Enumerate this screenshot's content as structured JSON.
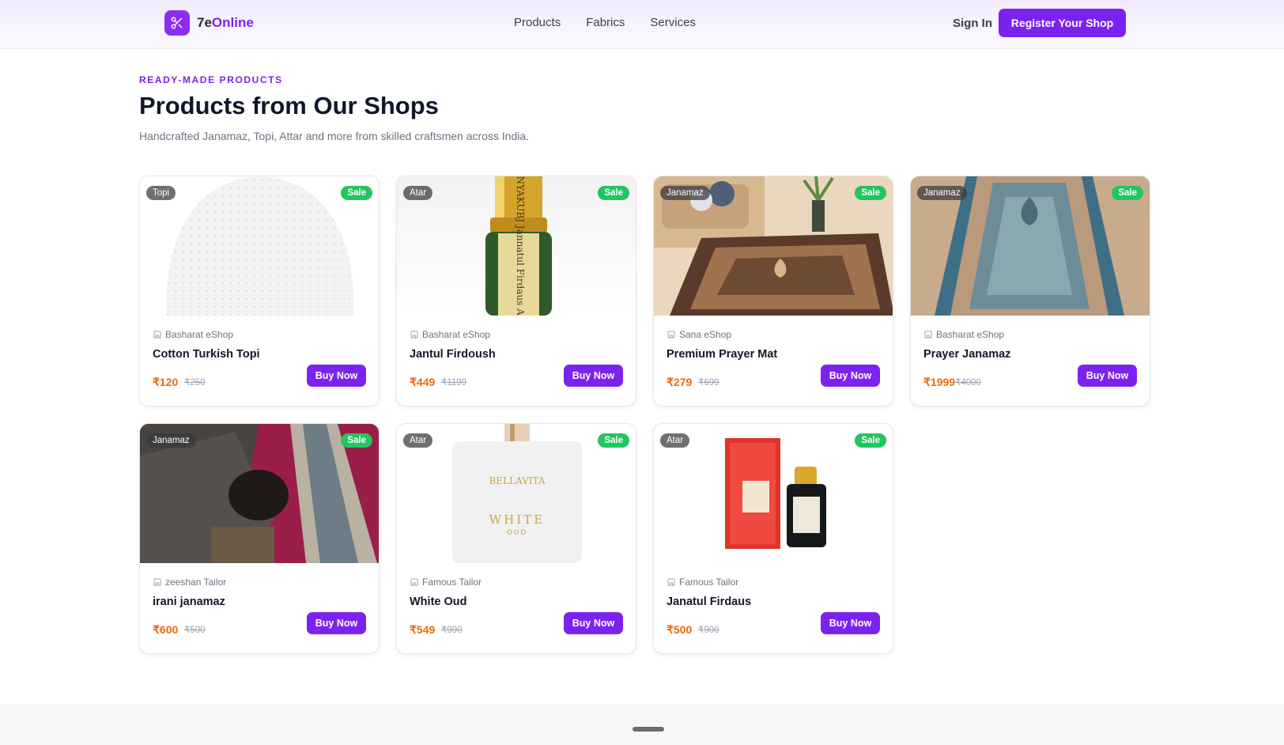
{
  "header": {
    "brand_prefix": "7e",
    "brand_accent": "Online",
    "nav": [
      "Products",
      "Fabrics",
      "Services"
    ],
    "sign_in": "Sign In",
    "register": "Register Your Shop"
  },
  "section": {
    "eyebrow": "READY-MADE PRODUCTS",
    "title": "Products from Our Shops",
    "subtitle": "Handcrafted Janamaz, Topi, Attar and more from skilled craftsmen across India."
  },
  "badge_sale": "Sale",
  "buy_label": "Buy Now",
  "products": [
    {
      "category": "Topi",
      "shop": "Basharat eShop",
      "name": "Cotton Turkish Topi",
      "price": "₹120",
      "mrp": "₹250"
    },
    {
      "category": "Atar",
      "shop": "Basharat eShop",
      "name": "Jantul Firdoush",
      "price": "₹449",
      "mrp": "₹1199"
    },
    {
      "category": "Janamaz",
      "shop": "Sana eShop",
      "name": "Premium Prayer Mat",
      "price": "₹279",
      "mrp": "₹699"
    },
    {
      "category": "Janamaz",
      "shop": "Basharat eShop",
      "name": "Prayer Janamaz",
      "price": "₹1999",
      "mrp": "₹4000"
    },
    {
      "category": "Janamaz",
      "shop": "zeeshan Tailor",
      "name": "irani janamaz",
      "price": "₹600",
      "mrp": "₹500"
    },
    {
      "category": "Atar",
      "shop": "Famous Tailor",
      "name": "White Oud",
      "price": "₹549",
      "mrp": "₹990"
    },
    {
      "category": "Atar",
      "shop": "Famous Tailor",
      "name": "Janatul Firdaus",
      "price": "₹500",
      "mrp": "₹900"
    }
  ],
  "image_text": {
    "attar_bottle": "KANYAKUBJ  Jannatul Firdaus  AttarKannauj.com",
    "perfume_brand": "BELLAVITA",
    "perfume_name": "WHITE",
    "perfume_sub": "OUD"
  },
  "colors": {
    "accent": "#7c22ef",
    "sale": "#22c55e",
    "price": "#ea6a0c"
  }
}
